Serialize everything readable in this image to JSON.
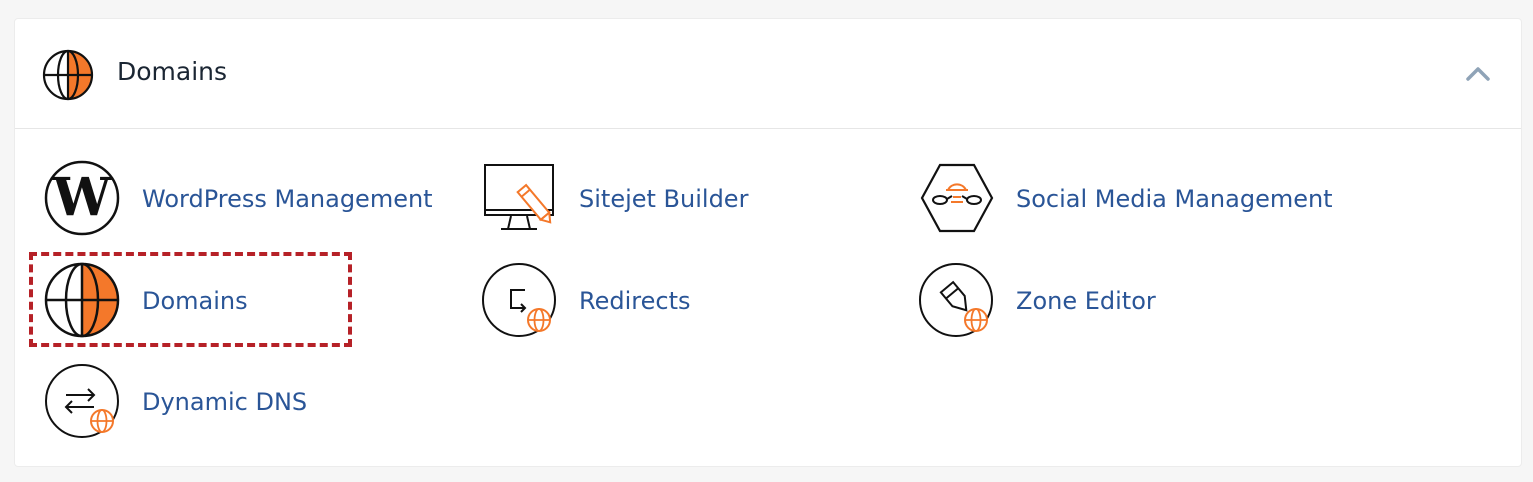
{
  "section": {
    "title": "Domains",
    "header_icon": "globe-icon",
    "collapse_icon": "chevron-up-icon"
  },
  "items": [
    {
      "label": "WordPress Management",
      "icon": "wordpress-icon"
    },
    {
      "label": "Sitejet Builder",
      "icon": "monitor-pencil-icon"
    },
    {
      "label": "Social Media Management",
      "icon": "social-media-icon"
    },
    {
      "label": "Domains",
      "icon": "globe-icon"
    },
    {
      "label": "Redirects",
      "icon": "redirect-globe-icon"
    },
    {
      "label": "Zone Editor",
      "icon": "zone-editor-globe-icon"
    },
    {
      "label": "Dynamic DNS",
      "icon": "swap-globe-icon"
    }
  ],
  "colors": {
    "accent_orange": "#f4782a",
    "link_blue": "#2a5597",
    "highlight_red": "#b62127"
  }
}
